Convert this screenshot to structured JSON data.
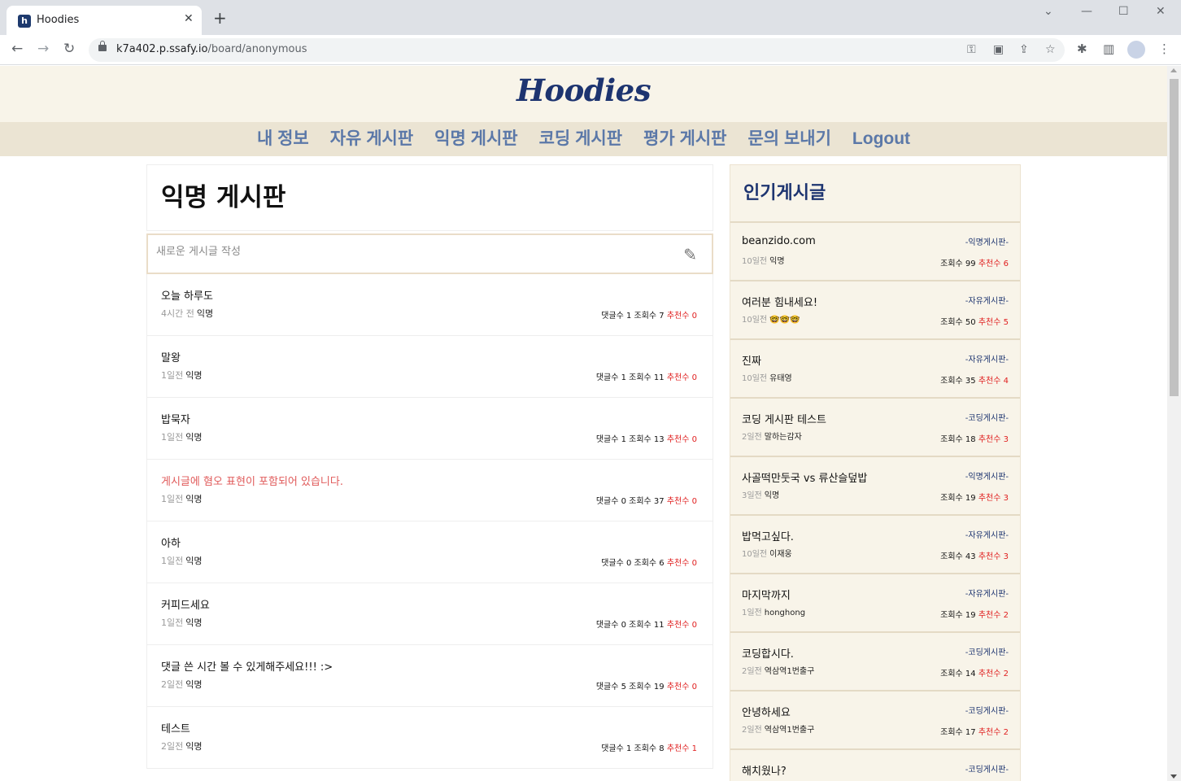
{
  "browser": {
    "tab_title": "Hoodies",
    "favicon_letter": "h",
    "url_host": "k7a402.p.ssafy.io",
    "url_path": "/board/anonymous"
  },
  "site": {
    "logo": "Hoodies",
    "nav": [
      "내 정보",
      "자유 게시판",
      "익명 게시판",
      "코딩 게시판",
      "평가 게시판",
      "문의 보내기",
      "Logout"
    ]
  },
  "board": {
    "title": "익명 게시판",
    "write_placeholder": "새로운 게시글 작성",
    "posts": [
      {
        "title": "오늘 하루도",
        "time": "4시간 전",
        "author": "익명",
        "stats": "댓글수 1 조회수 7",
        "rec": "추천수 0",
        "warn": false
      },
      {
        "title": "말왕",
        "time": "1일전",
        "author": "익명",
        "stats": "댓글수 1 조회수 11",
        "rec": "추천수 0",
        "warn": false
      },
      {
        "title": "밥묵자",
        "time": "1일전",
        "author": "익명",
        "stats": "댓글수 1 조회수 13",
        "rec": "추천수 0",
        "warn": false
      },
      {
        "title": "게시글에 혐오 표현이 포함되어 있습니다.",
        "time": "1일전",
        "author": "익명",
        "stats": "댓글수 0 조회수 37",
        "rec": "추천수 0",
        "warn": true
      },
      {
        "title": "아하",
        "time": "1일전",
        "author": "익명",
        "stats": "댓글수 0 조회수 6",
        "rec": "추천수 0",
        "warn": false
      },
      {
        "title": "커피드세요",
        "time": "1일전",
        "author": "익명",
        "stats": "댓글수 0 조회수 11",
        "rec": "추천수 0",
        "warn": false
      },
      {
        "title": "댓글 쓴 시간 볼 수 있게해주세요!!! :>",
        "time": "2일전",
        "author": "익명",
        "stats": "댓글수 5 조회수 19",
        "rec": "추천수 0",
        "warn": false
      },
      {
        "title": "테스트",
        "time": "2일전",
        "author": "익명",
        "stats": "댓글수 1 조회수 8",
        "rec": "추천수 1",
        "warn": false
      }
    ]
  },
  "popular": {
    "title": "인기게시글",
    "items": [
      {
        "title": "beanzido.com",
        "board": "-익명게시판-",
        "time": "10일전",
        "author": "익명",
        "stats": "조회수 99",
        "rec": "추천수 6"
      },
      {
        "title": "여러분 힘내세요!",
        "board": "-자유게시판-",
        "time": "10일전",
        "author": "🤓🤓🤓",
        "stats": "조회수 50",
        "rec": "추천수 5"
      },
      {
        "title": "진짜",
        "board": "-자유게시판-",
        "time": "10일전",
        "author": "유태영",
        "stats": "조회수 35",
        "rec": "추천수 4"
      },
      {
        "title": "코딩 게시판 테스트",
        "board": "-코딩게시판-",
        "time": "2일전",
        "author": "말하는감자",
        "stats": "조회수 18",
        "rec": "추천수 3"
      },
      {
        "title": "사골떡만둣국 vs 류산슬덮밥",
        "board": "-익명게시판-",
        "time": "3일전",
        "author": "익명",
        "stats": "조회수 19",
        "rec": "추천수 3"
      },
      {
        "title": "밥먹고싶다.",
        "board": "-자유게시판-",
        "time": "10일전",
        "author": "이재웅",
        "stats": "조회수 43",
        "rec": "추천수 3"
      },
      {
        "title": "마지막까지",
        "board": "-자유게시판-",
        "time": "1일전",
        "author": "honghong",
        "stats": "조회수 19",
        "rec": "추천수 2"
      },
      {
        "title": "코딩합시다.",
        "board": "-코딩게시판-",
        "time": "2일전",
        "author": "역삼역1번출구",
        "stats": "조회수 14",
        "rec": "추천수 2"
      },
      {
        "title": "안녕하세요",
        "board": "-코딩게시판-",
        "time": "2일전",
        "author": "역삼역1번출구",
        "stats": "조회수 17",
        "rec": "추천수 2"
      },
      {
        "title": "해치웠나?",
        "board": "-코딩게시판-",
        "time": "",
        "author": "",
        "stats": "",
        "rec": ""
      }
    ]
  },
  "colors": {
    "accent": "#1d3470",
    "header_bg": "#f8f4e9",
    "nav_bg": "#ebe4d3",
    "recommend": "#e02020"
  }
}
